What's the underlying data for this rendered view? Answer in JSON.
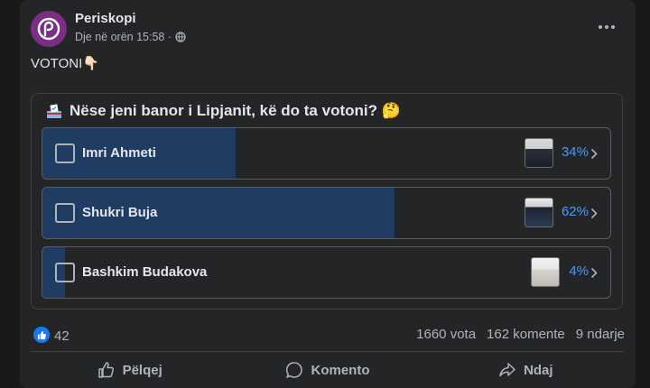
{
  "post": {
    "page_name": "Periskopi",
    "timestamp": "Dje në orën 15:58 ·",
    "text": "VOTONI👇🏻"
  },
  "poll": {
    "question": "Nëse jeni banor i Lipjanit, kë do ta votoni? 🤔",
    "options": [
      {
        "label": "Imri Ahmeti",
        "percent_text": "34%",
        "percent": 34
      },
      {
        "label": "Shukri Buja",
        "percent_text": "62%",
        "percent": 62
      },
      {
        "label": "Bashkim Budakova",
        "percent_text": "4%",
        "percent": 4
      }
    ]
  },
  "stats": {
    "likes": "42",
    "votes": "1660 vota",
    "comments": "162 komente",
    "shares": "9 ndarje"
  },
  "actions": {
    "like": "Pëlqej",
    "comment": "Komento",
    "share": "Ndaj"
  },
  "colors": {
    "accent": "#4599ff",
    "bar_fill": "#1f3d63",
    "avatar": "#7a2f85"
  }
}
